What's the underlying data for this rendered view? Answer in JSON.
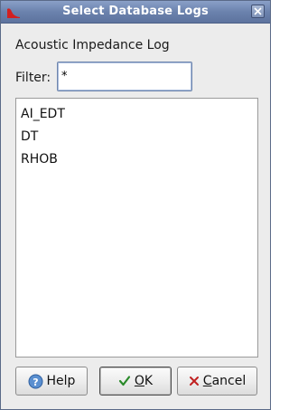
{
  "window": {
    "title": "Select Database Logs"
  },
  "dialog": {
    "log_label": "Acoustic Impedance Log",
    "filter_label": "Filter:",
    "filter_value": "*",
    "logs": [
      "AI_EDT",
      "DT",
      "RHOB"
    ]
  },
  "buttons": {
    "help_label": "Help",
    "ok_label": "OK",
    "ok_mnemonic": "O",
    "ok_rest": "K",
    "cancel_label": "Cancel",
    "cancel_mnemonic": "C",
    "cancel_rest": "ancel"
  },
  "icons": {
    "app": "app-logo-icon",
    "close": "close-icon",
    "help": "help-icon",
    "ok": "checkmark-icon",
    "cancel": "x-icon"
  },
  "colors": {
    "titlebar": "#6b82ad",
    "app_icon": "#d22020",
    "ok_check": "#2a8a2a",
    "cancel_x": "#c02020",
    "help_icon": "#5a8fd0"
  }
}
